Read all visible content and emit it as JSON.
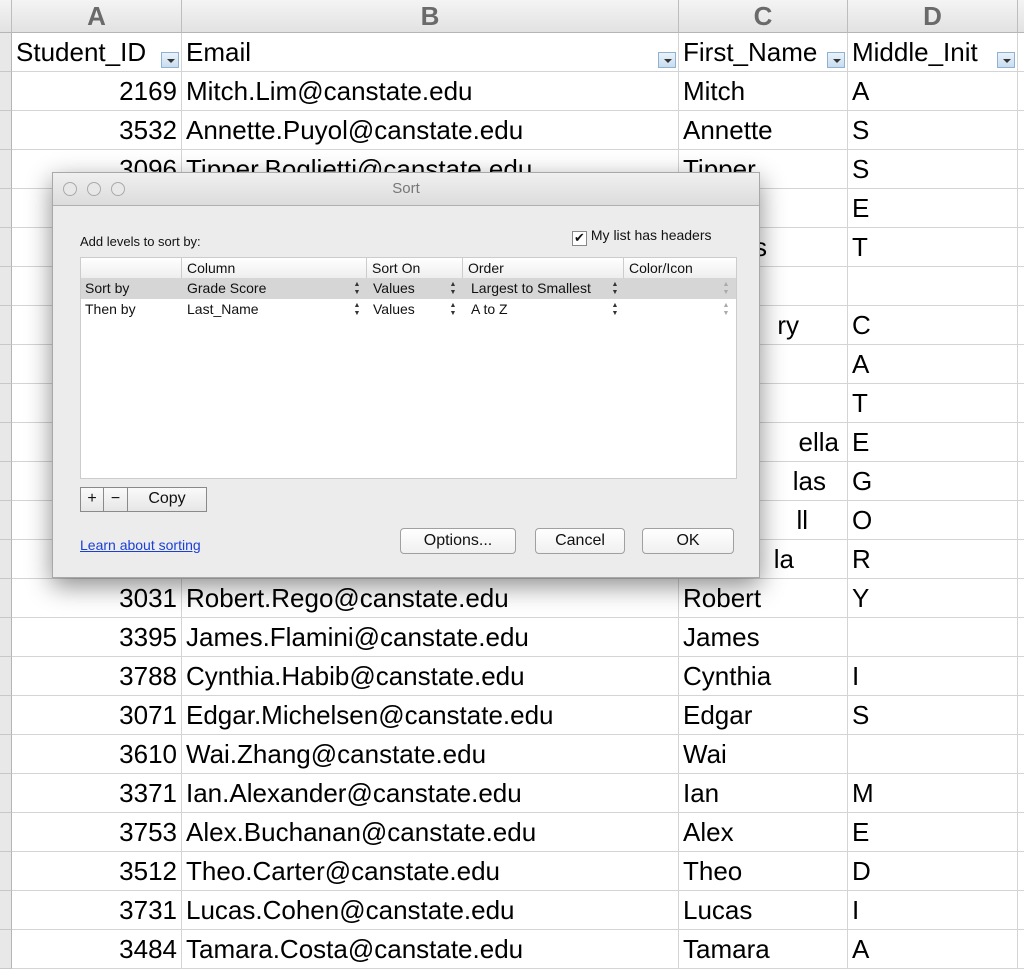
{
  "columns": [
    {
      "letter": "A",
      "header": "Student_ID"
    },
    {
      "letter": "B",
      "header": "Email"
    },
    {
      "letter": "C",
      "header": "First_Name"
    },
    {
      "letter": "D",
      "header": "Middle_Init"
    }
  ],
  "rows": [
    [
      "2169",
      "Mitch.Lim@canstate.edu",
      "Mitch",
      "A"
    ],
    [
      "3532",
      "Annette.Puyol@canstate.edu",
      "Annette",
      "S"
    ],
    [
      "3096",
      "Tipper.Boglietti@canstate.edu",
      "Tipper",
      "S"
    ],
    [
      "",
      "",
      "",
      "E"
    ],
    [
      "",
      "",
      "s",
      "T"
    ],
    [
      "",
      "",
      "",
      ""
    ],
    [
      "",
      "",
      "ry",
      "C"
    ],
    [
      "",
      "",
      "",
      "A"
    ],
    [
      "",
      "",
      "",
      "T"
    ],
    [
      "",
      "",
      "ella",
      "E"
    ],
    [
      "",
      "",
      "las",
      "G"
    ],
    [
      "",
      "",
      "ll",
      "O"
    ],
    [
      "",
      "",
      "la",
      "R"
    ],
    [
      "3031",
      "Robert.Rego@canstate.edu",
      "Robert",
      "Y"
    ],
    [
      "3395",
      "James.Flamini@canstate.edu",
      "James",
      ""
    ],
    [
      "3788",
      "Cynthia.Habib@canstate.edu",
      "Cynthia",
      "I"
    ],
    [
      "3071",
      "Edgar.Michelsen@canstate.edu",
      "Edgar",
      "S"
    ],
    [
      "3610",
      "Wai.Zhang@canstate.edu",
      "Wai",
      ""
    ],
    [
      "3371",
      "Ian.Alexander@canstate.edu",
      "Ian",
      "M"
    ],
    [
      "3753",
      "Alex.Buchanan@canstate.edu",
      "Alex",
      "E"
    ],
    [
      "3512",
      "Theo.Carter@canstate.edu",
      "Theo",
      "D"
    ],
    [
      "3731",
      "Lucas.Cohen@canstate.edu",
      "Lucas",
      "I"
    ],
    [
      "3484",
      "Tamara.Costa@canstate.edu",
      "Tamara",
      "A"
    ]
  ],
  "dialog": {
    "title": "Sort",
    "add_levels_label": "Add levels to sort by:",
    "headers_checkbox": {
      "label": "My list has headers",
      "checked": true
    },
    "table_headers": [
      "Column",
      "Sort On",
      "Order",
      "Color/Icon"
    ],
    "levels": [
      {
        "label": "Sort by",
        "column": "Grade Score",
        "sort_on": "Values",
        "order": "Largest to Smallest",
        "color_icon": ""
      },
      {
        "label": "Then by",
        "column": "Last_Name",
        "sort_on": "Values",
        "order": "A to Z",
        "color_icon": ""
      }
    ],
    "add_button": "+",
    "remove_button": "−",
    "copy_button": "Copy",
    "learn_link": "Learn about sorting",
    "options_button": "Options...",
    "cancel_button": "Cancel",
    "ok_button": "OK",
    "link_color": "#1a3fd6",
    "selected_row_color": "#d6d6d6"
  }
}
